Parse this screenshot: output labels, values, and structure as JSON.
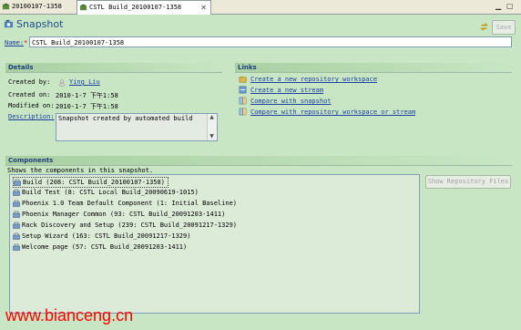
{
  "tabs": [
    {
      "label": "20100107-1358",
      "active": false,
      "icon": "snapshot-icon"
    },
    {
      "label": "CSTL Build_20100107-1358",
      "active": true,
      "icon": "snapshot-icon"
    }
  ],
  "header": {
    "title": "Snapshot",
    "save_label": "Save"
  },
  "name_field": {
    "label": "Name:",
    "required_mark": "*",
    "value": "CSTL Build_20100107-1358"
  },
  "details": {
    "section_title": "Details",
    "created_by_label": "Created by:",
    "created_by_value": "Ying Liu",
    "created_on_label": "Created on:",
    "created_on_value": "2010-1-7 下午1:58",
    "modified_on_label": "Modified on:",
    "modified_on_value": "2010-1-7 下午1:58",
    "description_label": "Description:",
    "description_value": "Snapshot created by automated build"
  },
  "links": {
    "section_title": "Links",
    "items": [
      "Create a new repository workspace",
      "Create a new stream",
      "Compare with snapshot",
      "Compare with repository workspace or stream"
    ]
  },
  "components": {
    "section_title": "Components",
    "subtitle": "Shows the components in this snapshot.",
    "show_button": "Show Repository Files",
    "rows": [
      "Build (208: CSTL Build_20100107-1358)",
      "Build Test (8: CSTL Local Build_20090619-1015)",
      "Phoenix 1.0 Team Default Component (1: Initial Baseline)",
      "Phoenix Manager Common (93: CSTL Build_20091203-1411)",
      "Rack Discovery and Setup (239: CSTL Build_20091217-1329)",
      "Setup Wizard (163: CSTL Build_20091217-1329)",
      "Welcome page (57: CSTL Build_20091203-1411)"
    ]
  },
  "watermark": "www.bianceng.cn",
  "colors": {
    "background": "#c8e6c4",
    "link": "#1d3fa0",
    "title": "#1d4d8c",
    "watermark": "#ff0000"
  }
}
